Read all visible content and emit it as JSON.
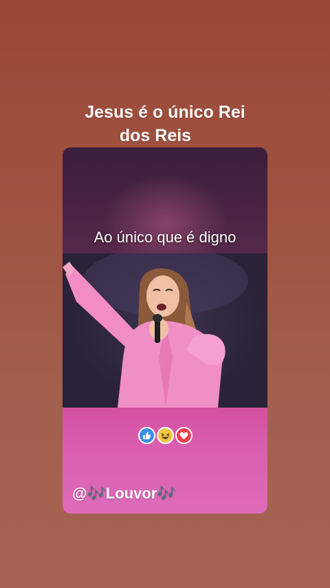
{
  "title": {
    "line1": "Jesus é o único Rei",
    "line2": "dos Reis"
  },
  "video": {
    "caption": "Ao único que é digno",
    "reactions": [
      "thumbs-up-icon",
      "laughing-face-icon",
      "heart-icon"
    ],
    "handle": {
      "prefix": "@",
      "note_left": "🎶",
      "name": "Louvor",
      "note_right": "🎶"
    }
  },
  "colors": {
    "background": "#a05442",
    "accent_pink": "#d95cae",
    "like_blue": "#3a8ee6",
    "love_red": "#ee3c4f",
    "haha_yellow": "#f6c647"
  }
}
